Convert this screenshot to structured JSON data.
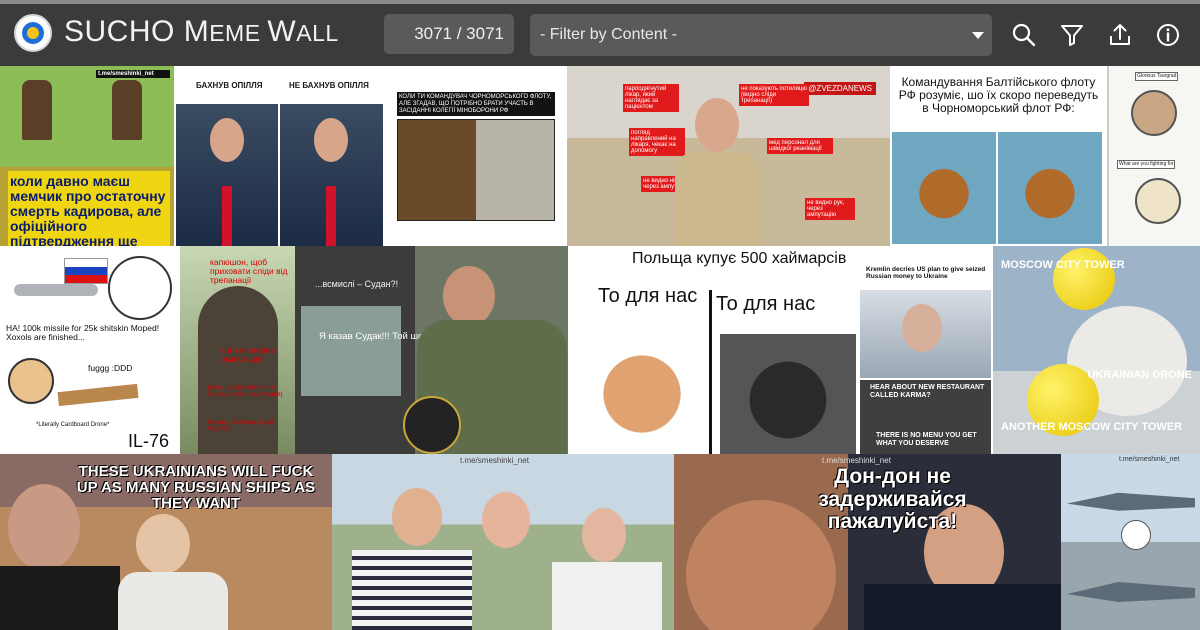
{
  "header": {
    "title_main_1": "SUCHO ",
    "title_cap_m": "M",
    "title_small_1": "EME ",
    "title_cap_w": "W",
    "title_small_2": "ALL",
    "counter": "3071 / 3071",
    "filter_placeholder": "- Filter by Content -",
    "icons": [
      "search-icon",
      "filter-icon",
      "share-icon",
      "info-icon"
    ]
  },
  "tiles": {
    "t1": {
      "caption": "коли давно маєш мемчик про остаточну смерть кадирова, але офіційного підтвердження ще немає",
      "corner": "t.me/smeshinki_net"
    },
    "t2": {
      "left_label": "БАХНУВ ОПІЛЛЯ",
      "right_label": "НЕ БАХНУВ ОПІЛЛЯ"
    },
    "t3": {
      "header": "КОЛИ ТИ КОМАНДУВАЧ ЧОРНОМОРСЬКОГО ФЛОТУ, АЛЕ ЗГАДАВ, ЩО ПОТРІБНО БРАТИ УЧАСТЬ В ЗАСІДАННІ КОЛЕГІЇ МІНОБОРОНИ РФ"
    },
    "t4": {
      "tag": "@ZVEZDANEWS",
      "labels": [
        "пароодягнутий лікар, який наглядає за пацієнтом",
        "не показують потилицю (видно сліди трепанації)",
        "погляд направлений на лікаря, чекає на допомогу",
        "мед персонал для швидкої реанімації",
        "не видно ніг, через ампутацію",
        "не видно рук, через ампутацію"
      ]
    },
    "t5": {
      "caption": "Командування Балтійського флоту РФ розуміє, шо їх скоро переведуть в Чорноморський флот РФ:"
    },
    "t6": {
      "caption_top": "Glorious Tsargrad",
      "caption_bottom": "What are you fighting for"
    },
    "t7": {
      "c1": "HA! 100k missile for 25k shitskin Moped! Xoxols are finished...",
      "c2": "fuggg :DDD",
      "c3": "*Literally Cardboard Drone*",
      "c4": "IL-76"
    },
    "t8": {
      "c1": "капюшон, щоб приховати сліди від трепанації",
      "c2": "ноги не видно (ампутація)",
      "c3": "рука, що приховати не спромоглися (ампутація)",
      "c4": "борода, приховує сліди інсульту"
    },
    "t9": {
      "c1": "...всмислі – Судан?!",
      "c2": "Я казав Судак!!! Той шо в Криму!"
    },
    "t10": {
      "title": "Польща купує 500 хаймарсів",
      "left": "То для нас",
      "right": "То для нас"
    },
    "t11": {
      "headline": "Kremlin decries US plan to give seized Russian money to Ukraine",
      "top_text": "HEAR ABOUT NEW RESTAURANT CALLED KARMA?",
      "bottom_text": "THERE IS NO MENU YOU GET WHAT YOU DESERVE"
    },
    "t12": {
      "top": "MOSCOW CITY TOWER",
      "right": "UKRAINIAN DRONE",
      "bottom": "ANOTHER MOSCOW CITY TOWER"
    },
    "t13": {
      "caption": "THESE UKRAINIANS WILL FUCK UP AS MANY RUSSIAN SHIPS AS THEY WANT"
    },
    "t14": {
      "watermark": "t.me/smeshinki_net"
    },
    "t15": {
      "caption": "Дон-дон не задерживайся пажалуйста!",
      "watermark": "t.me/smeshinki_net"
    },
    "t16": {
      "watermark": "t.me/smeshinki_net"
    }
  },
  "colors": {
    "topbar": "#3b3b3c",
    "field": "#5a5a5b",
    "accent_red": "#e11b1b"
  }
}
